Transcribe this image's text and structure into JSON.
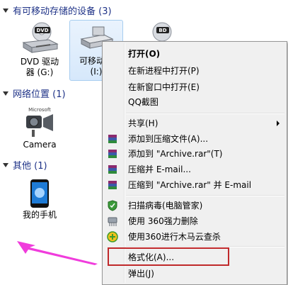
{
  "sections": {
    "removable": "有可移动存储的设备 (3)",
    "network": "网络位置 (1)",
    "other": "其他 (1)"
  },
  "devices": {
    "dvd_line1": "DVD 驱动",
    "dvd_line2": "器 (G:)",
    "removable_line1": "可移动磁",
    "removable_line2": "(I:)",
    "bd_badge": "BD",
    "dvd_badge": "DVD",
    "camera": "Camera",
    "camera_brand": "Microsoft",
    "phone": "我的手机"
  },
  "menu": {
    "open": "打开(O)",
    "open_new_process": "在新进程中打开(P)",
    "open_new_window": "在新窗口中打开(E)",
    "qq_screenshot": "QQ截图",
    "share": "共享(H)",
    "add_to_archive": "添加到压缩文件(A)...",
    "add_to_archive_rar": "添加到 \"Archive.rar\"(T)",
    "compress_email": "压缩并 E-mail...",
    "compress_rar_email": "压缩到 \"Archive.rar\" 并 E-mail",
    "scan_virus": "扫描病毒(电脑管家)",
    "force_delete_360": "使用 360强力删除",
    "trojan_scan_360": "使用360进行木马云查杀",
    "format": "格式化(A)...",
    "eject": "弹出(J)"
  },
  "colors": {
    "section_text": "#1e3287",
    "menu_bg": "#f0f0f0",
    "highlight_box": "#c0292b",
    "pointer_arrow": "#f03cdc"
  }
}
